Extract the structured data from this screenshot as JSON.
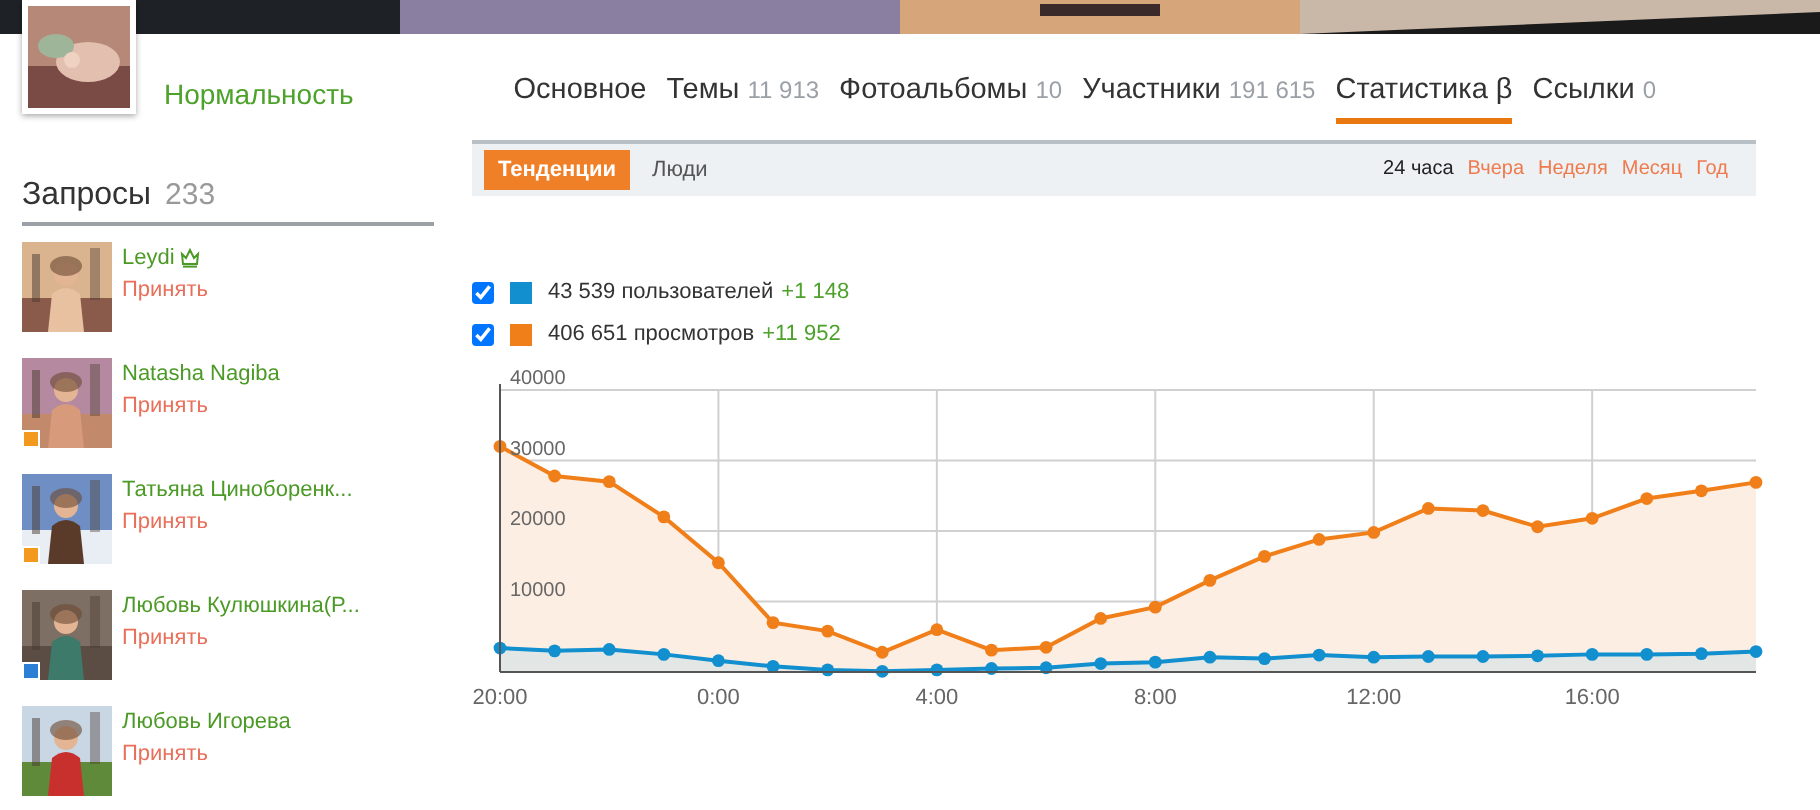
{
  "group": {
    "name": "Нормальность"
  },
  "nav_tabs": [
    {
      "label": "Основное",
      "selected": false
    },
    {
      "label": "Темы",
      "count": "11 913",
      "selected": false
    },
    {
      "label": "Фотоальбомы",
      "count": "10",
      "selected": false
    },
    {
      "label": "Участники",
      "count": "191 615",
      "selected": false
    },
    {
      "label": "Статистика β",
      "selected": true
    },
    {
      "label": "Ссылки",
      "count": "0",
      "selected": false
    }
  ],
  "requests": {
    "title": "Запросы",
    "count": "233",
    "items": [
      {
        "name": "Leydi",
        "crown": true,
        "action": "Принять"
      },
      {
        "name": "Natasha Nagiba",
        "crown": false,
        "action": "Принять",
        "color": "#f39a1e"
      },
      {
        "name": "Татьяна Циноборенк...",
        "crown": false,
        "action": "Принять",
        "color": "#f39a1e"
      },
      {
        "name": "Любовь Кулюшкина(Р...",
        "crown": false,
        "action": "Принять",
        "color": "#2b7fd4"
      },
      {
        "name": "Любовь Игорева",
        "crown": false,
        "action": "Принять"
      }
    ]
  },
  "stats": {
    "view_tabs": [
      {
        "label": "Тенденции",
        "selected": true
      },
      {
        "label": "Люди",
        "selected": false
      }
    ],
    "periods": [
      {
        "label": "24 часа",
        "selected": true
      },
      {
        "label": "Вчера",
        "selected": false
      },
      {
        "label": "Неделя",
        "selected": false
      },
      {
        "label": "Месяц",
        "selected": false
      },
      {
        "label": "Год",
        "selected": false
      }
    ],
    "legend": [
      {
        "checked": true,
        "color": "#118fcf",
        "label": "43 539 пользователей",
        "delta": "+1 148"
      },
      {
        "checked": true,
        "color": "#f07f1a",
        "label": "406 651 просмотров",
        "delta": "+11 952"
      }
    ],
    "chart_data": {
      "type": "area",
      "grid": true,
      "categories": [
        "20:00",
        null,
        null,
        null,
        "0:00",
        null,
        null,
        null,
        "4:00",
        null,
        null,
        null,
        "8:00",
        null,
        null,
        null,
        "12:00",
        null,
        null,
        null,
        "16:00",
        null,
        null,
        null
      ],
      "ylim": [
        0,
        40000
      ],
      "yticks": [
        10000,
        20000,
        30000,
        40000
      ],
      "series": [
        {
          "color": "#118fcf",
          "values": [
            3400,
            3000,
            3200,
            2500,
            1600,
            800,
            300,
            100,
            300,
            500,
            600,
            1200,
            1400,
            2100,
            1900,
            2400,
            2100,
            2200,
            2200,
            2300,
            2500,
            2500,
            2600,
            2900
          ]
        },
        {
          "color": "#f07f1a",
          "values": [
            32000,
            27800,
            27000,
            22000,
            15500,
            7000,
            5800,
            2800,
            6000,
            3100,
            3500,
            7600,
            9200,
            13000,
            16400,
            18800,
            19800,
            23200,
            22900,
            20600,
            21800,
            24600,
            25700,
            26900
          ]
        }
      ]
    }
  }
}
